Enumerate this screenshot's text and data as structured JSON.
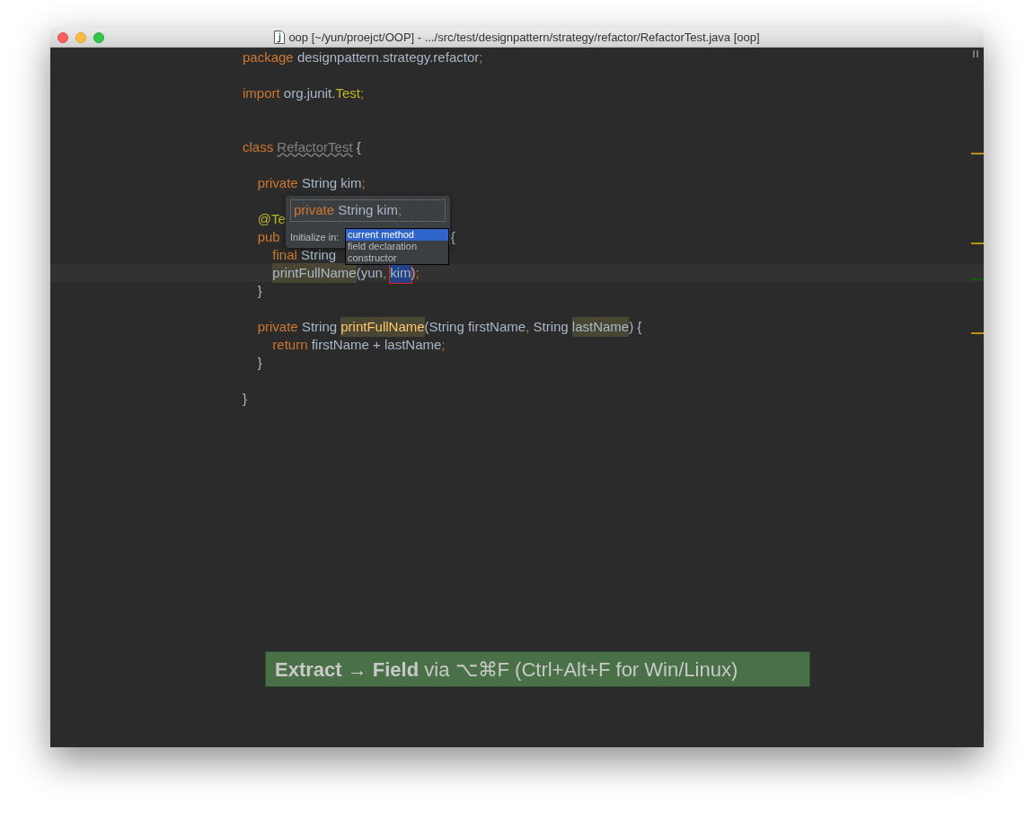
{
  "window": {
    "title": "oop [~/yun/proejct/OOP] - .../src/test/designpattern/strategy/refactor/RefactorTest.java [oop]"
  },
  "code_lines": [
    {
      "kind": "code",
      "tokens": [
        {
          "text": "package ",
          "kind": "keyword"
        },
        {
          "text": "designpattern.strategy.refactor",
          "kind": "plain"
        },
        {
          "text": ";",
          "kind": "punct"
        }
      ]
    },
    {
      "kind": "blank"
    },
    {
      "kind": "code",
      "tokens": [
        {
          "text": "import ",
          "kind": "keyword"
        },
        {
          "text": "org.junit.",
          "kind": "plain"
        },
        {
          "text": "Test",
          "kind": "annotation"
        },
        {
          "text": ";",
          "kind": "punct"
        }
      ]
    },
    {
      "kind": "blank"
    },
    {
      "kind": "blank"
    },
    {
      "kind": "code",
      "tokens": [
        {
          "text": "class ",
          "kind": "keyword"
        },
        {
          "text": "RefactorTest",
          "kind": "unused"
        },
        {
          "text": " {",
          "kind": "plain"
        }
      ]
    },
    {
      "kind": "blank"
    },
    {
      "kind": "code",
      "tokens": [
        {
          "text": "    private ",
          "kind": "keyword"
        },
        {
          "text": "String kim",
          "kind": "plain"
        },
        {
          "text": ";",
          "kind": "punct"
        }
      ]
    },
    {
      "kind": "blank"
    },
    {
      "kind": "code",
      "tokens": [
        {
          "text": "    @Te",
          "kind": "annotation"
        }
      ]
    },
    {
      "kind": "code",
      "tokens": [
        {
          "text": "    pub",
          "kind": "keyword"
        },
        {
          "text": "{",
          "kind": "plain",
          "behind_popup": true
        }
      ]
    },
    {
      "kind": "code",
      "tokens": [
        {
          "text": "        final ",
          "kind": "keyword"
        },
        {
          "text": "String",
          "kind": "plain"
        }
      ]
    },
    {
      "kind": "code",
      "current": true,
      "tokens": [
        {
          "text": "        printFullName",
          "kind": "usage"
        },
        {
          "text": "(yun",
          "kind": "plain"
        },
        {
          "text": ", ",
          "kind": "punct"
        },
        {
          "text": "kim",
          "kind": "selection"
        },
        {
          "text": ")",
          "kind": "plain"
        },
        {
          "text": ";",
          "kind": "punct"
        }
      ]
    },
    {
      "kind": "code",
      "tokens": [
        {
          "text": "    }",
          "kind": "plain"
        }
      ]
    },
    {
      "kind": "blank"
    },
    {
      "kind": "code",
      "tokens": [
        {
          "text": "    private ",
          "kind": "keyword"
        },
        {
          "text": "String ",
          "kind": "plain"
        },
        {
          "text": "printFullName",
          "kind": "declaration"
        },
        {
          "text": "(String firstName",
          "kind": "plain"
        },
        {
          "text": ", ",
          "kind": "punct"
        },
        {
          "text": "String ",
          "kind": "plain"
        },
        {
          "text": "lastName",
          "kind": "usage"
        },
        {
          "text": ") {",
          "kind": "plain"
        }
      ]
    },
    {
      "kind": "code",
      "tokens": [
        {
          "text": "        return ",
          "kind": "keyword"
        },
        {
          "text": "firstName + lastName",
          "kind": "plain"
        },
        {
          "text": ";",
          "kind": "punct"
        }
      ]
    },
    {
      "kind": "code",
      "tokens": [
        {
          "text": "    }",
          "kind": "plain"
        }
      ]
    },
    {
      "kind": "blank"
    },
    {
      "kind": "code",
      "tokens": [
        {
          "text": "}",
          "kind": "plain"
        }
      ]
    }
  ],
  "popup": {
    "field_tokens": [
      {
        "text": "private ",
        "kind": "keyword"
      },
      {
        "text": "String kim",
        "kind": "plain"
      },
      {
        "text": ";",
        "kind": "punct"
      }
    ],
    "initialize_label": "Initialize in:",
    "options": [
      {
        "label": "current method",
        "selected": true
      },
      {
        "label": "field declaration",
        "selected": false
      },
      {
        "label": "constructor",
        "selected": false
      }
    ]
  },
  "banner": {
    "bold": "Extract → Field",
    "rest": " via ⌥⌘F (Ctrl+Alt+F for Win/Linux)"
  }
}
